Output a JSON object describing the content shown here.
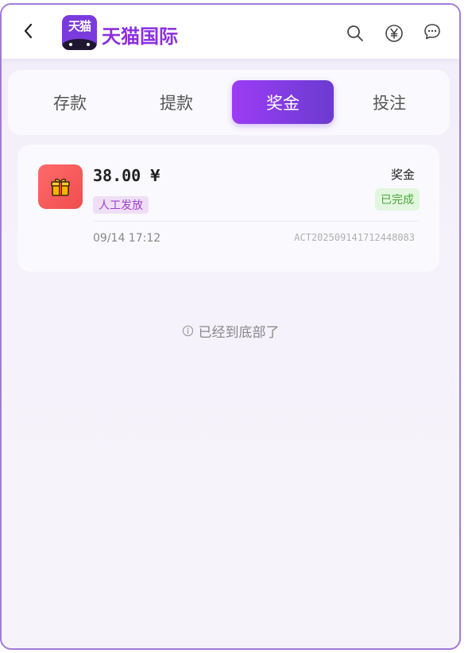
{
  "header": {
    "logo_text": "天猫",
    "brand": "天猫国际",
    "icons": [
      "back-icon",
      "search-icon",
      "yuan-icon",
      "message-icon"
    ]
  },
  "tabs": [
    {
      "label": "存款",
      "active": false
    },
    {
      "label": "提款",
      "active": false
    },
    {
      "label": "奖金",
      "active": true
    },
    {
      "label": "投注",
      "active": false
    }
  ],
  "record": {
    "amount": "38.00 ¥",
    "tag": "人工发放",
    "type": "奖金",
    "status": "已完成",
    "time": "09/14 17:12",
    "order_no": "ACT202509141712448083"
  },
  "footer": {
    "end_text": "已经到底部了"
  },
  "colors": {
    "accent": "#8a2fe0",
    "tab_active_start": "#9b3cf5",
    "tab_active_end": "#6b3bd0",
    "status_green": "#4aa63b",
    "gift_red": "#f04e4e"
  }
}
